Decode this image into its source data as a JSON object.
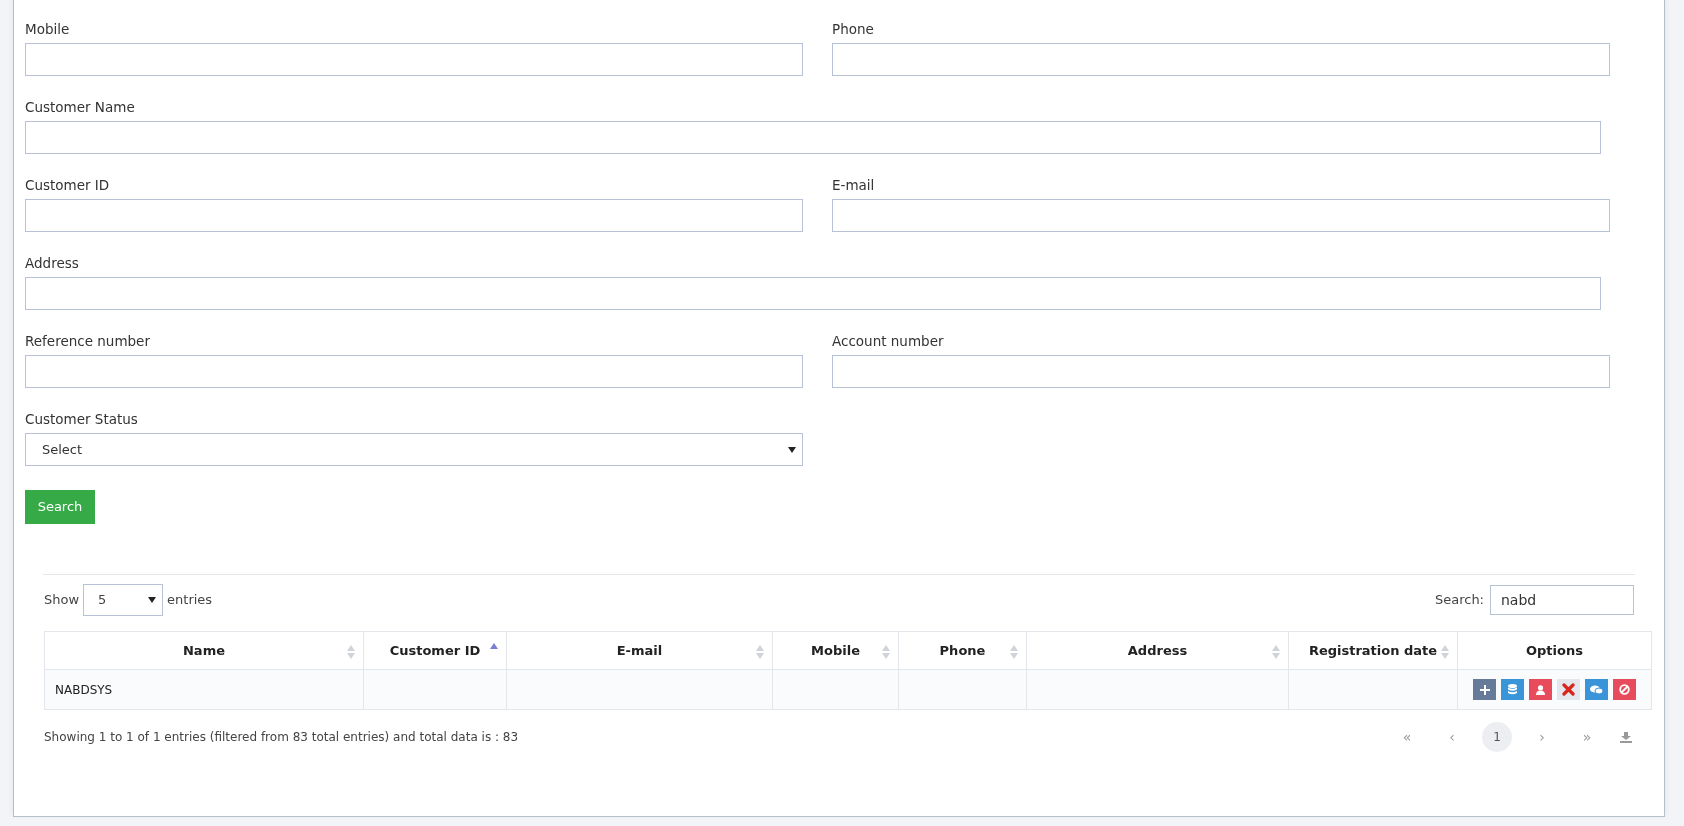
{
  "form": {
    "rows": [
      {
        "fields": [
          {
            "label": "Mobile",
            "kind": "text"
          },
          {
            "label": "Phone",
            "kind": "text"
          }
        ]
      },
      {
        "fields": [
          {
            "label": "Customer Name",
            "kind": "text"
          }
        ]
      },
      {
        "fields": [
          {
            "label": "Customer ID",
            "kind": "text"
          },
          {
            "label": "E-mail",
            "kind": "text"
          }
        ]
      },
      {
        "fields": [
          {
            "label": "Address",
            "kind": "text"
          }
        ]
      },
      {
        "fields": [
          {
            "label": "Reference number",
            "kind": "text"
          },
          {
            "label": "Account number",
            "kind": "text"
          }
        ]
      },
      {
        "fields": [
          {
            "label": "Customer Status",
            "kind": "select",
            "value": "Select"
          }
        ]
      }
    ],
    "search_button": "Search"
  },
  "table_controls": {
    "show_label": "Show",
    "page_size": "5",
    "entries_label": "entries",
    "search_label": "Search:",
    "search_value": "nabd"
  },
  "table": {
    "columns": [
      {
        "label": "Name",
        "sortable": true,
        "sorted": false
      },
      {
        "label": "Customer ID",
        "sortable": true,
        "sorted": true
      },
      {
        "label": "E-mail",
        "sortable": true,
        "sorted": false
      },
      {
        "label": "Mobile",
        "sortable": true,
        "sorted": false
      },
      {
        "label": "Phone",
        "sortable": true,
        "sorted": false
      },
      {
        "label": "Address",
        "sortable": true,
        "sorted": false
      },
      {
        "label": "Registration date",
        "sortable": true,
        "sorted": false
      },
      {
        "label": "Options",
        "sortable": false
      }
    ],
    "rows": [
      {
        "cells": [
          "NABDSYS",
          "",
          "",
          "",
          "",
          "",
          ""
        ],
        "options": [
          {
            "kind": "add",
            "color": "#667b9a"
          },
          {
            "kind": "database",
            "color": "#3a95d8"
          },
          {
            "kind": "user",
            "color": "#e84c5c"
          },
          {
            "kind": "delete",
            "color": "#e4e7ec"
          },
          {
            "kind": "chat",
            "color": "#3a95d8"
          },
          {
            "kind": "block",
            "color": "#e84c5c"
          }
        ]
      }
    ]
  },
  "footer": {
    "info": "Showing 1 to 1 of 1 entries (filtered from 83 total entries) and total data is : 83",
    "pagination": [
      {
        "label": "«",
        "selected": false
      },
      {
        "label": "‹",
        "selected": false
      },
      {
        "label": "1",
        "selected": true
      },
      {
        "label": "›",
        "selected": false
      },
      {
        "label": "»",
        "selected": false
      }
    ]
  }
}
